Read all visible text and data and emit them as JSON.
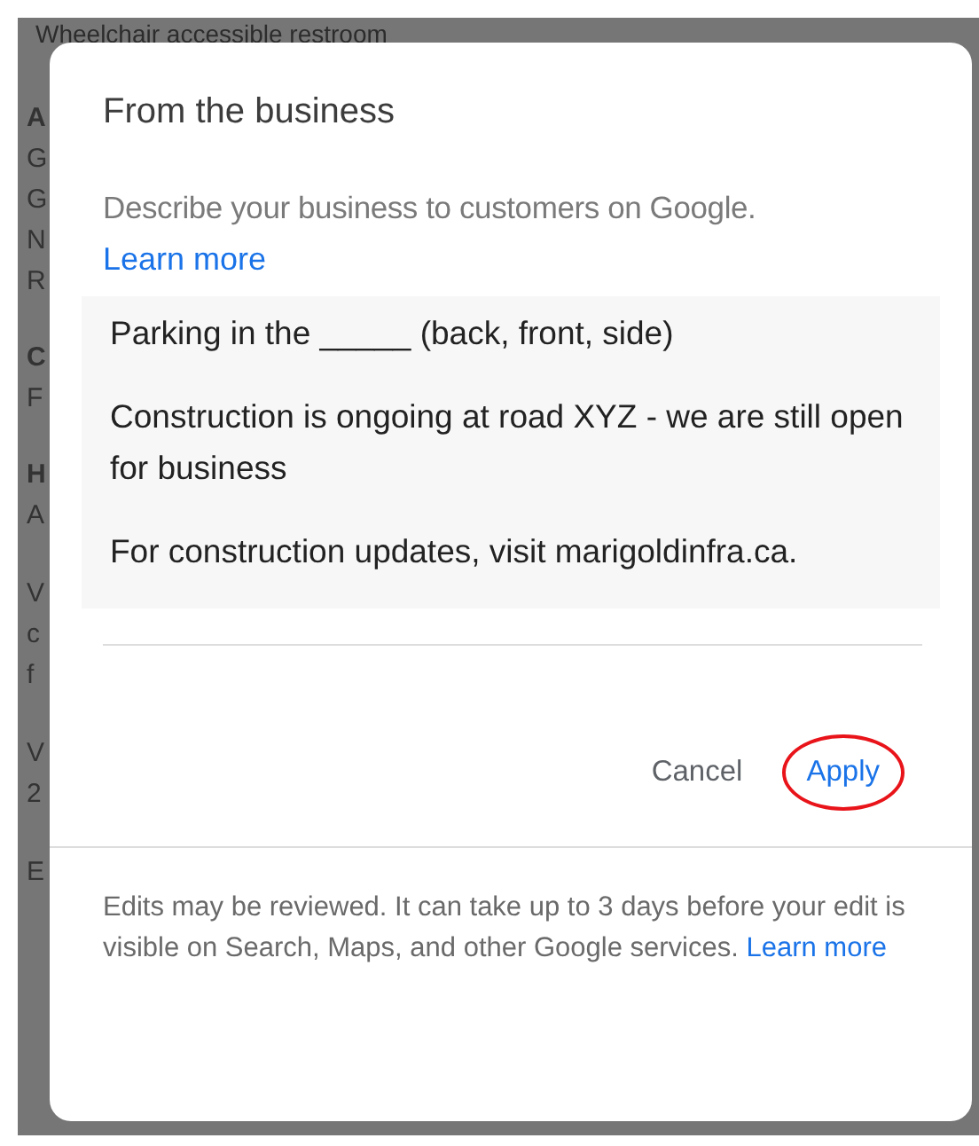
{
  "background": {
    "top_line": "Wheelchair accessible restroom",
    "sections": [
      {
        "heading": "A",
        "lines": [
          "G",
          "G",
          "N",
          "R"
        ]
      },
      {
        "heading": "C",
        "lines": [
          "F"
        ]
      },
      {
        "heading": "H",
        "lines": [
          "A"
        ]
      },
      {
        "lines": [
          "V",
          "c",
          "f"
        ]
      },
      {
        "lines": [
          "V",
          "2"
        ]
      },
      {
        "lines": [
          "E"
        ]
      }
    ]
  },
  "dialog": {
    "title": "From the business",
    "description": "Describe your business to customers on Google.",
    "description_link": "Learn more",
    "paragraphs": [
      "Parking in the _____ (back, front, side)",
      "Construction is ongoing at road XYZ - we are still open for business",
      "For construction updates, visit marigoldinfra.ca."
    ],
    "buttons": [
      {
        "label": "Cancel",
        "kind": "text",
        "highlighted": false
      },
      {
        "label": "Apply",
        "kind": "primary",
        "highlighted": true
      }
    ],
    "footer": "Edits may be reviewed. It can take up to 3 days before your edit is visible on Search, Maps, and other Google services.",
    "footer_link": "Learn more"
  }
}
